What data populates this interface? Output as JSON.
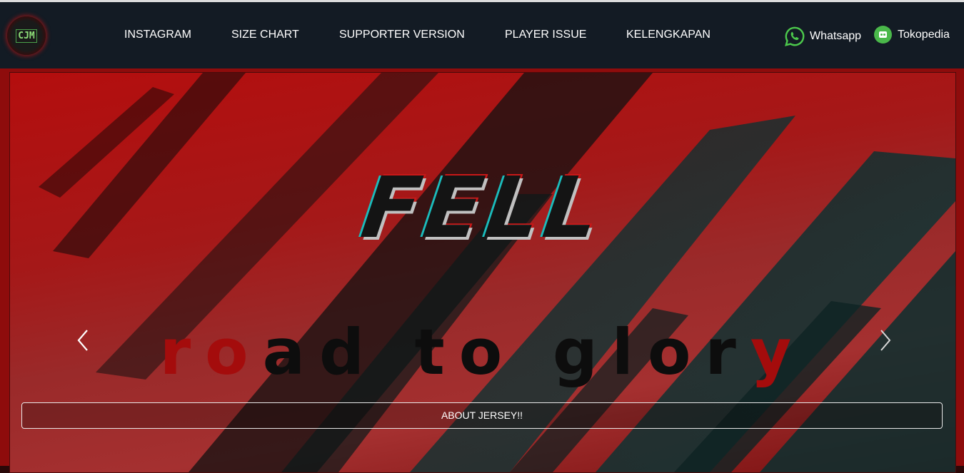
{
  "logo": {
    "text": "CJM"
  },
  "nav": {
    "links": [
      "INSTAGRAM",
      "SIZE CHART",
      "SUPPORTER VERSION",
      "PLAYER ISSUE",
      "KELENGKAPAN"
    ]
  },
  "social": {
    "whatsapp": {
      "label": "Whatsapp",
      "icon": "whatsapp-icon"
    },
    "tokopedia": {
      "label": "Tokopedia",
      "icon": "tokopedia-icon"
    }
  },
  "hero": {
    "title": "FELL",
    "subtitle_red_1": "ro",
    "subtitle_dark": "ad to glor",
    "subtitle_red_2": "y",
    "button_label": "ABOUT JERSEY!!",
    "prev_icon": "chevron-left-icon",
    "next_icon": "chevron-right-icon"
  },
  "colors": {
    "navbar": "#131b24",
    "hero_red": "#b40e0e",
    "accent_green": "#4ab84a"
  }
}
